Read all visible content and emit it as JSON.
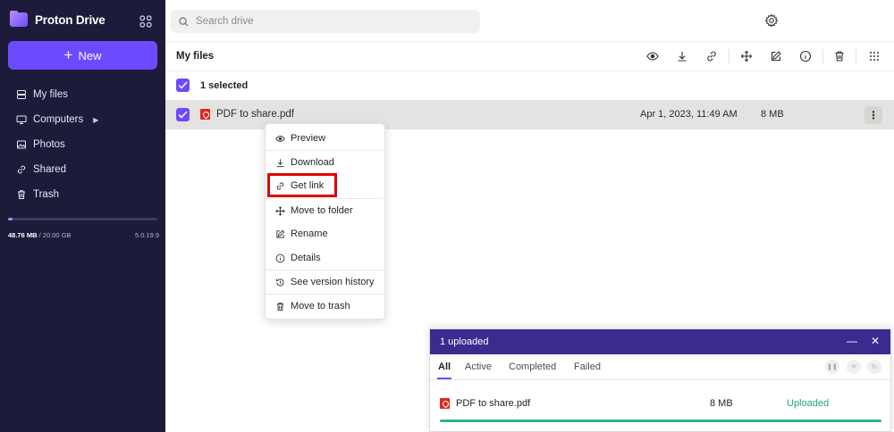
{
  "app": {
    "name": "Proton Drive"
  },
  "sidebar": {
    "new_label": "New",
    "items": [
      {
        "label": "My files",
        "icon": "server-icon"
      },
      {
        "label": "Computers",
        "icon": "monitor-icon"
      },
      {
        "label": "Photos",
        "icon": "image-icon"
      },
      {
        "label": "Shared",
        "icon": "link-icon"
      },
      {
        "label": "Trash",
        "icon": "trash-icon"
      }
    ],
    "storage": {
      "used": "48.76 MB",
      "sep": " / ",
      "total": "20.00 GB",
      "fraction": 0.0024
    },
    "version": "5.0.19.9"
  },
  "topbar": {
    "search_placeholder": "Search drive"
  },
  "main": {
    "title": "My files",
    "selected_text": "1 selected",
    "files": [
      {
        "name": "PDF to share.pdf",
        "modified": "Apr 1, 2023, 11:49 AM",
        "size": "8 MB"
      }
    ]
  },
  "context_menu": {
    "items": [
      {
        "label": "Preview",
        "icon": "eye-icon"
      },
      {
        "label": "Download",
        "icon": "download-icon"
      },
      {
        "label": "Get link",
        "icon": "link-icon"
      },
      {
        "label": "Move to folder",
        "icon": "move-icon"
      },
      {
        "label": "Rename",
        "icon": "pencil-icon"
      },
      {
        "label": "Details",
        "icon": "info-icon"
      },
      {
        "label": "See version history",
        "icon": "history-icon"
      },
      {
        "label": "Move to trash",
        "icon": "trash-icon"
      }
    ],
    "highlight_color": "#e00000"
  },
  "upload": {
    "title": "1 uploaded",
    "tabs": [
      "All",
      "Active",
      "Completed",
      "Failed"
    ],
    "file": {
      "name": "PDF to share.pdf",
      "size": "8 MB",
      "status": "Uploaded",
      "progress": 1.0
    }
  },
  "colors": {
    "accent": "#6d4aff",
    "sidebar_bg": "#1c1b3a",
    "upload_header": "#3b2b8f",
    "success": "#1ea672"
  }
}
